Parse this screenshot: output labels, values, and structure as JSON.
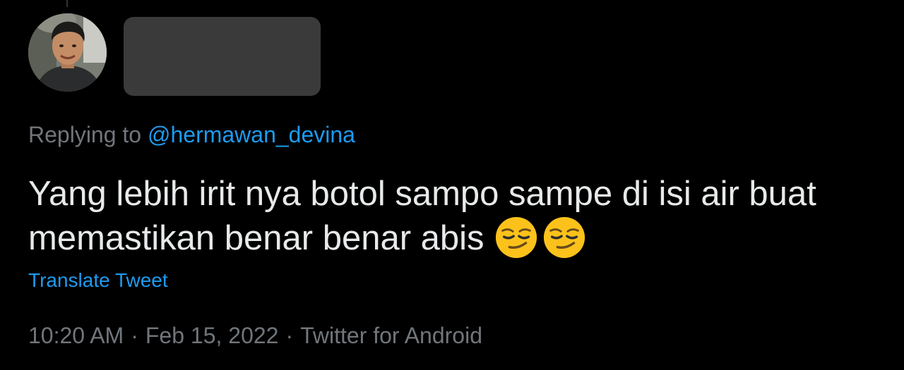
{
  "colors": {
    "background": "#000000",
    "primary_text": "#e7e9ea",
    "secondary_text": "#71767b",
    "link": "#1d9bf0",
    "redaction": "#3a3a3a"
  },
  "author": {
    "avatar_icon": "profile-photo",
    "name_redacted": true
  },
  "reply": {
    "prefix": "Replying to",
    "mention": "@hermawan_devina"
  },
  "tweet": {
    "line1": "Yang lebih irit nya botol sampo sampe di isi air buat",
    "line2": "memastikan benar benar abis",
    "emojis": [
      "smirking-face",
      "smirking-face"
    ],
    "translate_label": "Translate Tweet"
  },
  "meta": {
    "time": "10:20 AM",
    "separator": "·",
    "date": "Feb 15, 2022",
    "source": "Twitter for Android"
  }
}
